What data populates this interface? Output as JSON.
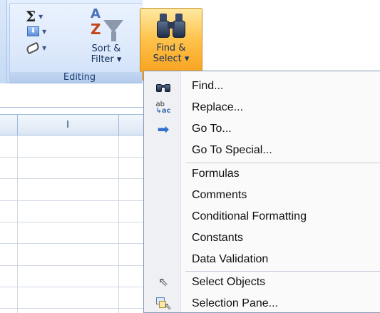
{
  "ribbon": {
    "group_label": "Editing",
    "autosum_glyph": "Σ",
    "fill_glyph": "⬇",
    "sort_filter": {
      "line1": "Sort &",
      "line2": "Filter ▾",
      "glyph_a": "A",
      "glyph_z": "Z"
    },
    "find_select": {
      "line1": "Find &",
      "line2": "Select ▾"
    }
  },
  "sheet": {
    "column_label": "I"
  },
  "menu": {
    "items": [
      {
        "label": "Find...",
        "icon": "binoculars-icon"
      },
      {
        "label": "Replace...",
        "icon": "replace-icon"
      },
      {
        "label": "Go To...",
        "icon": "arrow-right-icon"
      },
      {
        "label": "Go To Special...",
        "icon": ""
      },
      {
        "label": "Formulas",
        "icon": ""
      },
      {
        "label": "Comments",
        "icon": ""
      },
      {
        "label": "Conditional Formatting",
        "icon": ""
      },
      {
        "label": "Constants",
        "icon": ""
      },
      {
        "label": "Data Validation",
        "icon": ""
      },
      {
        "label": "Select Objects",
        "icon": "cursor-arrow-icon"
      },
      {
        "label": "Selection Pane...",
        "icon": "selection-pane-icon"
      }
    ]
  }
}
